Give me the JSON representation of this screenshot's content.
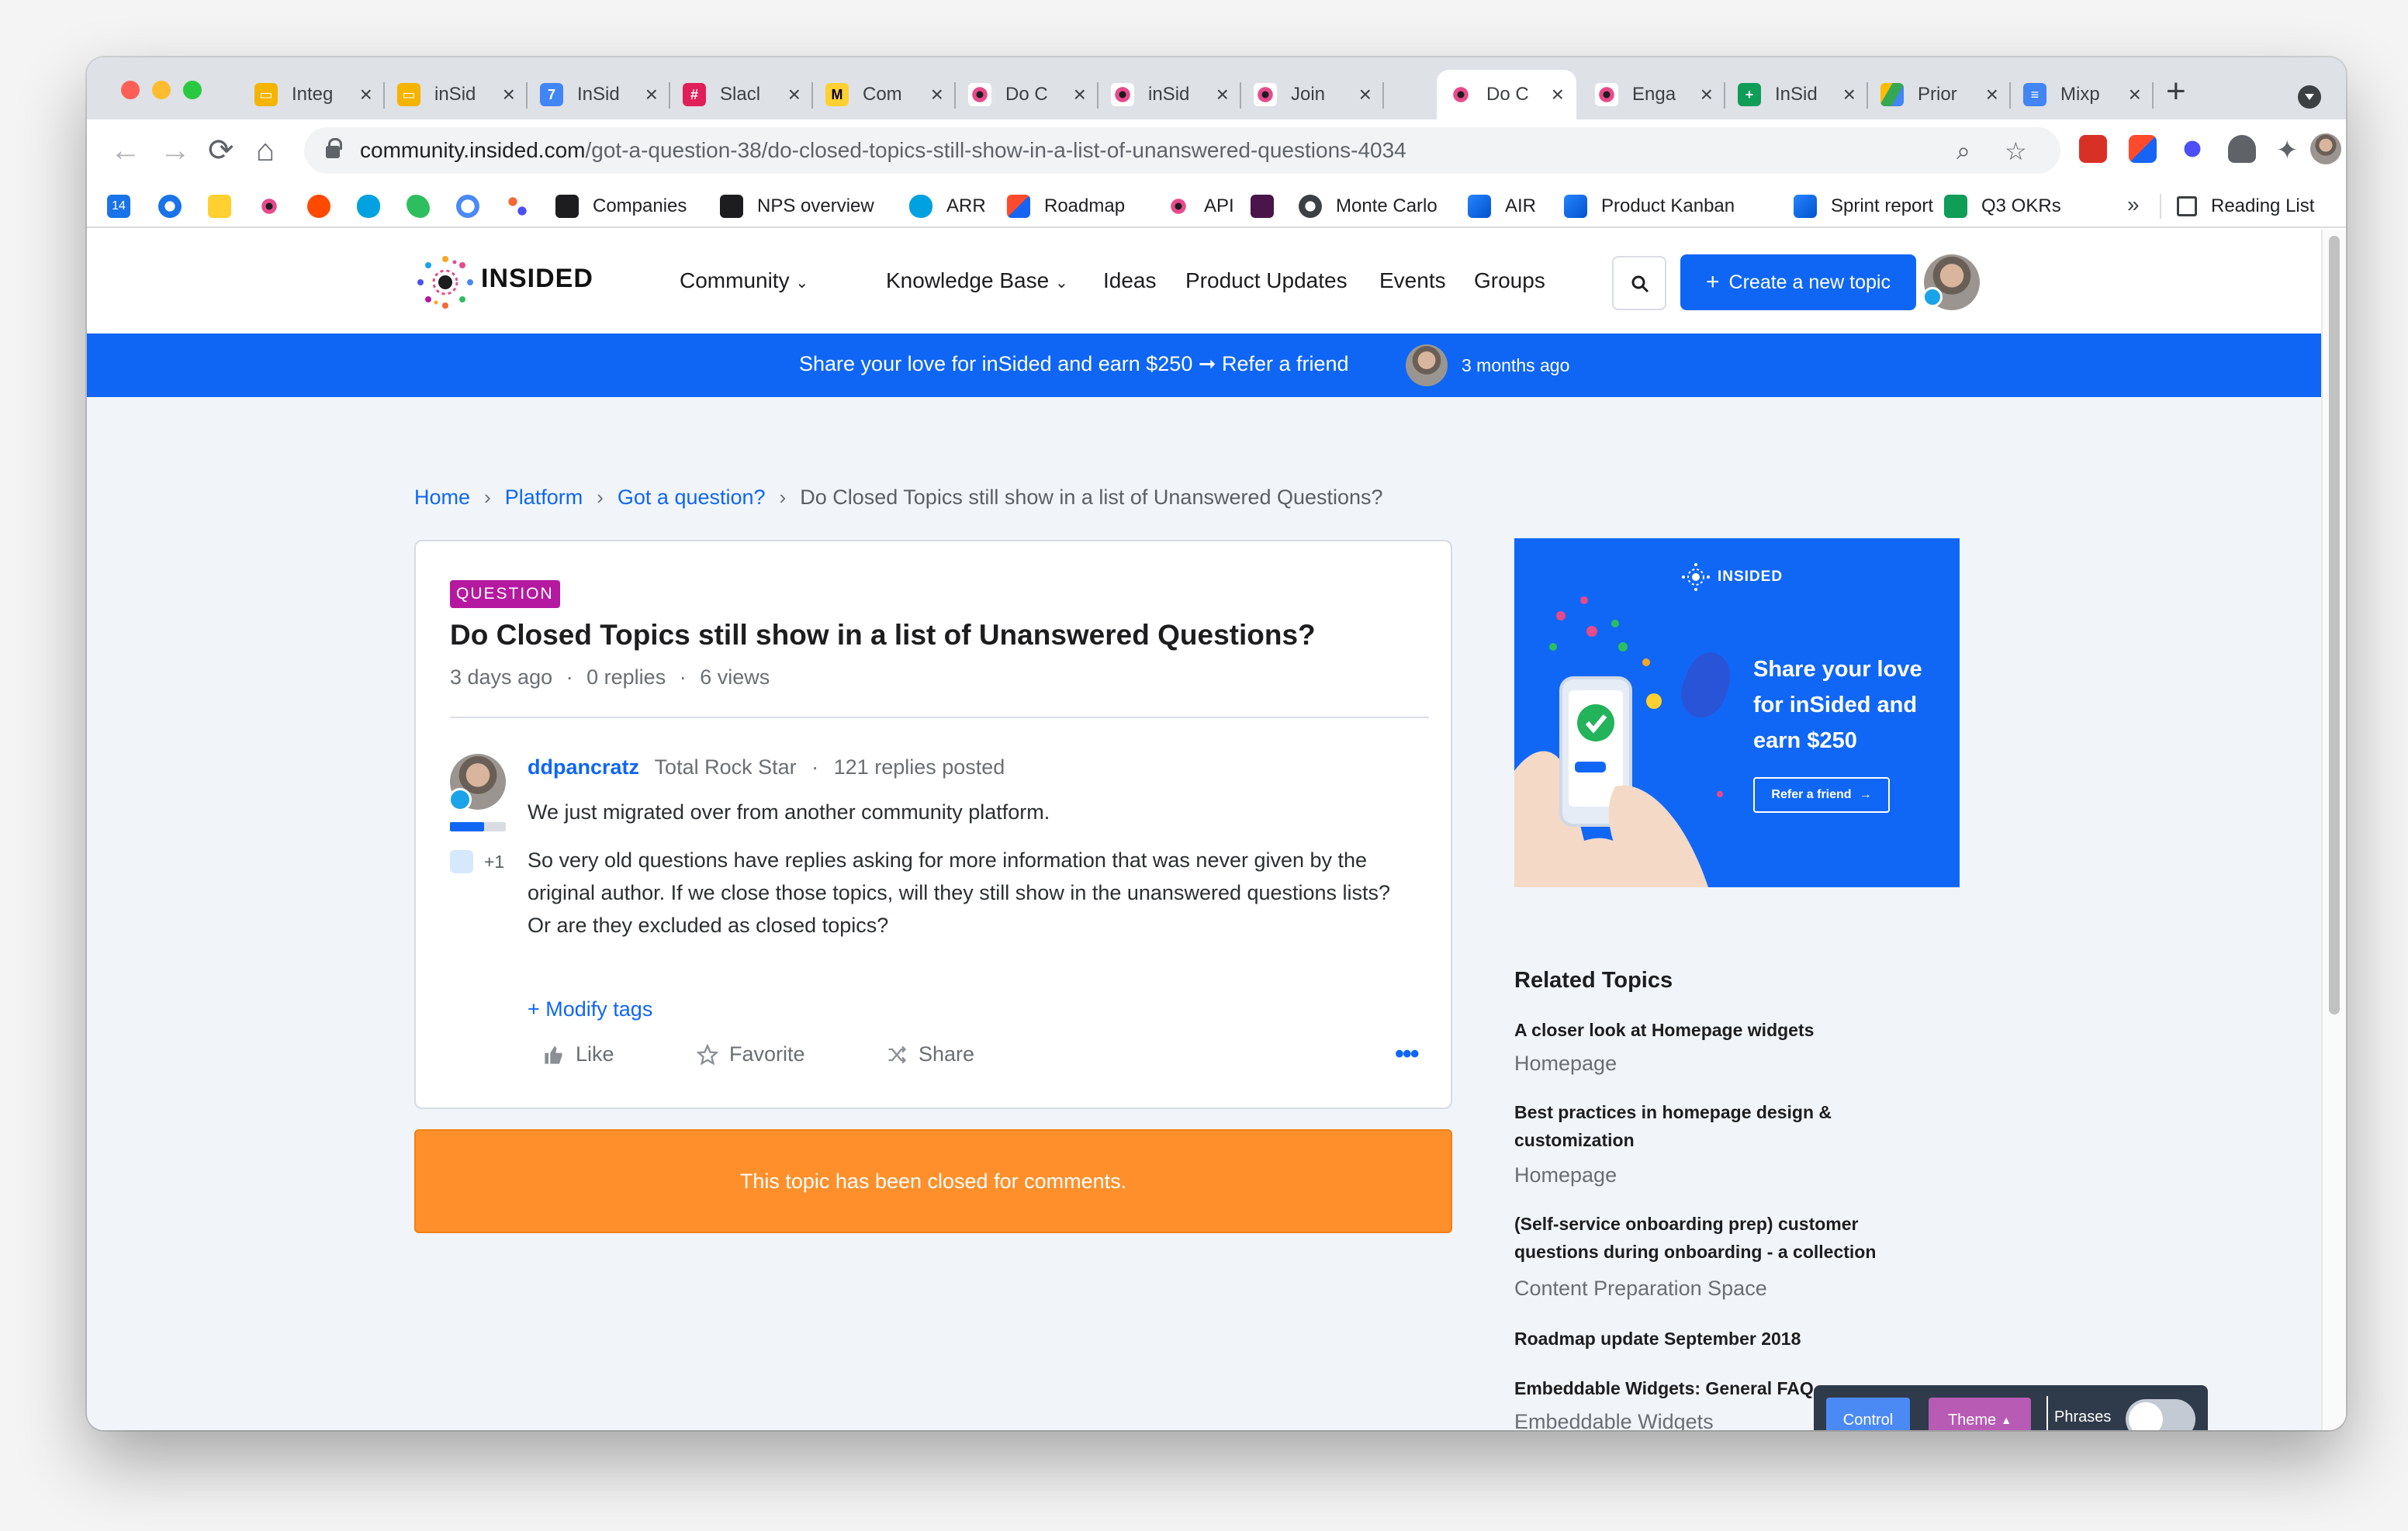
{
  "browser": {
    "tabs": [
      {
        "title": "Integ",
        "icon": "google-slides-icon",
        "color": "#f4b400"
      },
      {
        "title": "inSid",
        "icon": "google-slides-icon",
        "color": "#f4b400"
      },
      {
        "title": "InSid",
        "icon": "google-calendar-icon",
        "color": "#4285f4"
      },
      {
        "title": "Slacl",
        "icon": "slack-icon",
        "color": "#e01e5a"
      },
      {
        "title": "Com",
        "icon": "miro-icon",
        "color": "#ffd02f"
      },
      {
        "title": "Do C",
        "icon": "insided-icon",
        "color": "#e84a8a"
      },
      {
        "title": "inSid",
        "icon": "insided-icon",
        "color": "#e84a8a"
      },
      {
        "title": "Join",
        "icon": "insided-icon",
        "color": "#e84a8a"
      },
      {
        "title": "Do C",
        "icon": "insided-icon",
        "color": "#e84a8a"
      },
      {
        "title": "Enga",
        "icon": "insided-icon",
        "color": "#e84a8a"
      },
      {
        "title": "InSid",
        "icon": "google-sheets-icon",
        "color": "#0f9d58"
      },
      {
        "title": "Prior",
        "icon": "google-drive-icon",
        "color": "#fbbc04"
      },
      {
        "title": "Mixp",
        "icon": "google-docs-icon",
        "color": "#4285f4"
      }
    ],
    "url_host": "community.insided.com",
    "url_path": "/got-a-question-38/do-closed-topics-still-show-in-a-list-of-unanswered-questions-4034",
    "bookmarks": [
      {
        "label": "Companies"
      },
      {
        "label": "NPS overview"
      },
      {
        "label": "ARR"
      },
      {
        "label": "Roadmap"
      },
      {
        "label": "API"
      },
      {
        "label": "Monte Carlo"
      },
      {
        "label": "AIR"
      },
      {
        "label": "Product Kanban"
      },
      {
        "label": "Sprint report"
      },
      {
        "label": "Q3 OKRs"
      }
    ],
    "calendar_day": "14",
    "bookmarks_more": "»",
    "reading_list": "Reading List"
  },
  "site": {
    "logo_text": "INSIDED",
    "nav": [
      "Community",
      "Knowledge Base",
      "Ideas",
      "Product Updates",
      "Events",
      "Groups"
    ],
    "create_button": "Create a new topic",
    "accent": "#0f66f5"
  },
  "banner": {
    "text": "Share your love for inSided and earn $250 ➞ Refer a friend",
    "time": "3 months ago"
  },
  "breadcrumb": {
    "home": "Home",
    "platform": "Platform",
    "category": "Got a question?",
    "current": "Do Closed Topics still show in a list of Unanswered Questions?"
  },
  "topic": {
    "badge": "QUESTION",
    "title": "Do Closed Topics still show in a list of Unanswered Questions?",
    "age": "3 days ago",
    "replies": "0 replies",
    "views": "6 views",
    "author": "ddpancratz",
    "author_rank": "Total Rock Star",
    "author_replies": "121 replies posted",
    "like_count": "+1",
    "body_p1": "We just migrated over from another community platform.",
    "body_p2": "So very old questions have replies asking for more information that was never given by the original author. If we close those topics, will they still show in the unanswered questions lists? Or are they excluded as closed topics?",
    "modify_tags": "+ Modify tags",
    "actions": {
      "like": "Like",
      "favorite": "Favorite",
      "share": "Share"
    },
    "closed_notice": "This topic has been closed for comments.",
    "closed_color": "#ff8f2a"
  },
  "promo": {
    "logo": "INSIDED",
    "headline": "Share your love for inSided and earn $250",
    "button": "Refer a friend"
  },
  "related": {
    "title": "Related Topics",
    "items": [
      {
        "title": "A closer look at Homepage widgets",
        "category": "Homepage"
      },
      {
        "title": "Best practices in homepage design & customization",
        "category": "Homepage"
      },
      {
        "title": "(Self-service onboarding prep) customer questions during onboarding - a collection",
        "category": "Content Preparation Space"
      },
      {
        "title": "Roadmap update September 2018",
        "category": ""
      },
      {
        "title": "Embeddable Widgets: General FAQ",
        "category": "Embeddable Widgets"
      }
    ]
  },
  "widget": {
    "control": "Control",
    "theme": "Theme",
    "phrases": "Phrases"
  }
}
